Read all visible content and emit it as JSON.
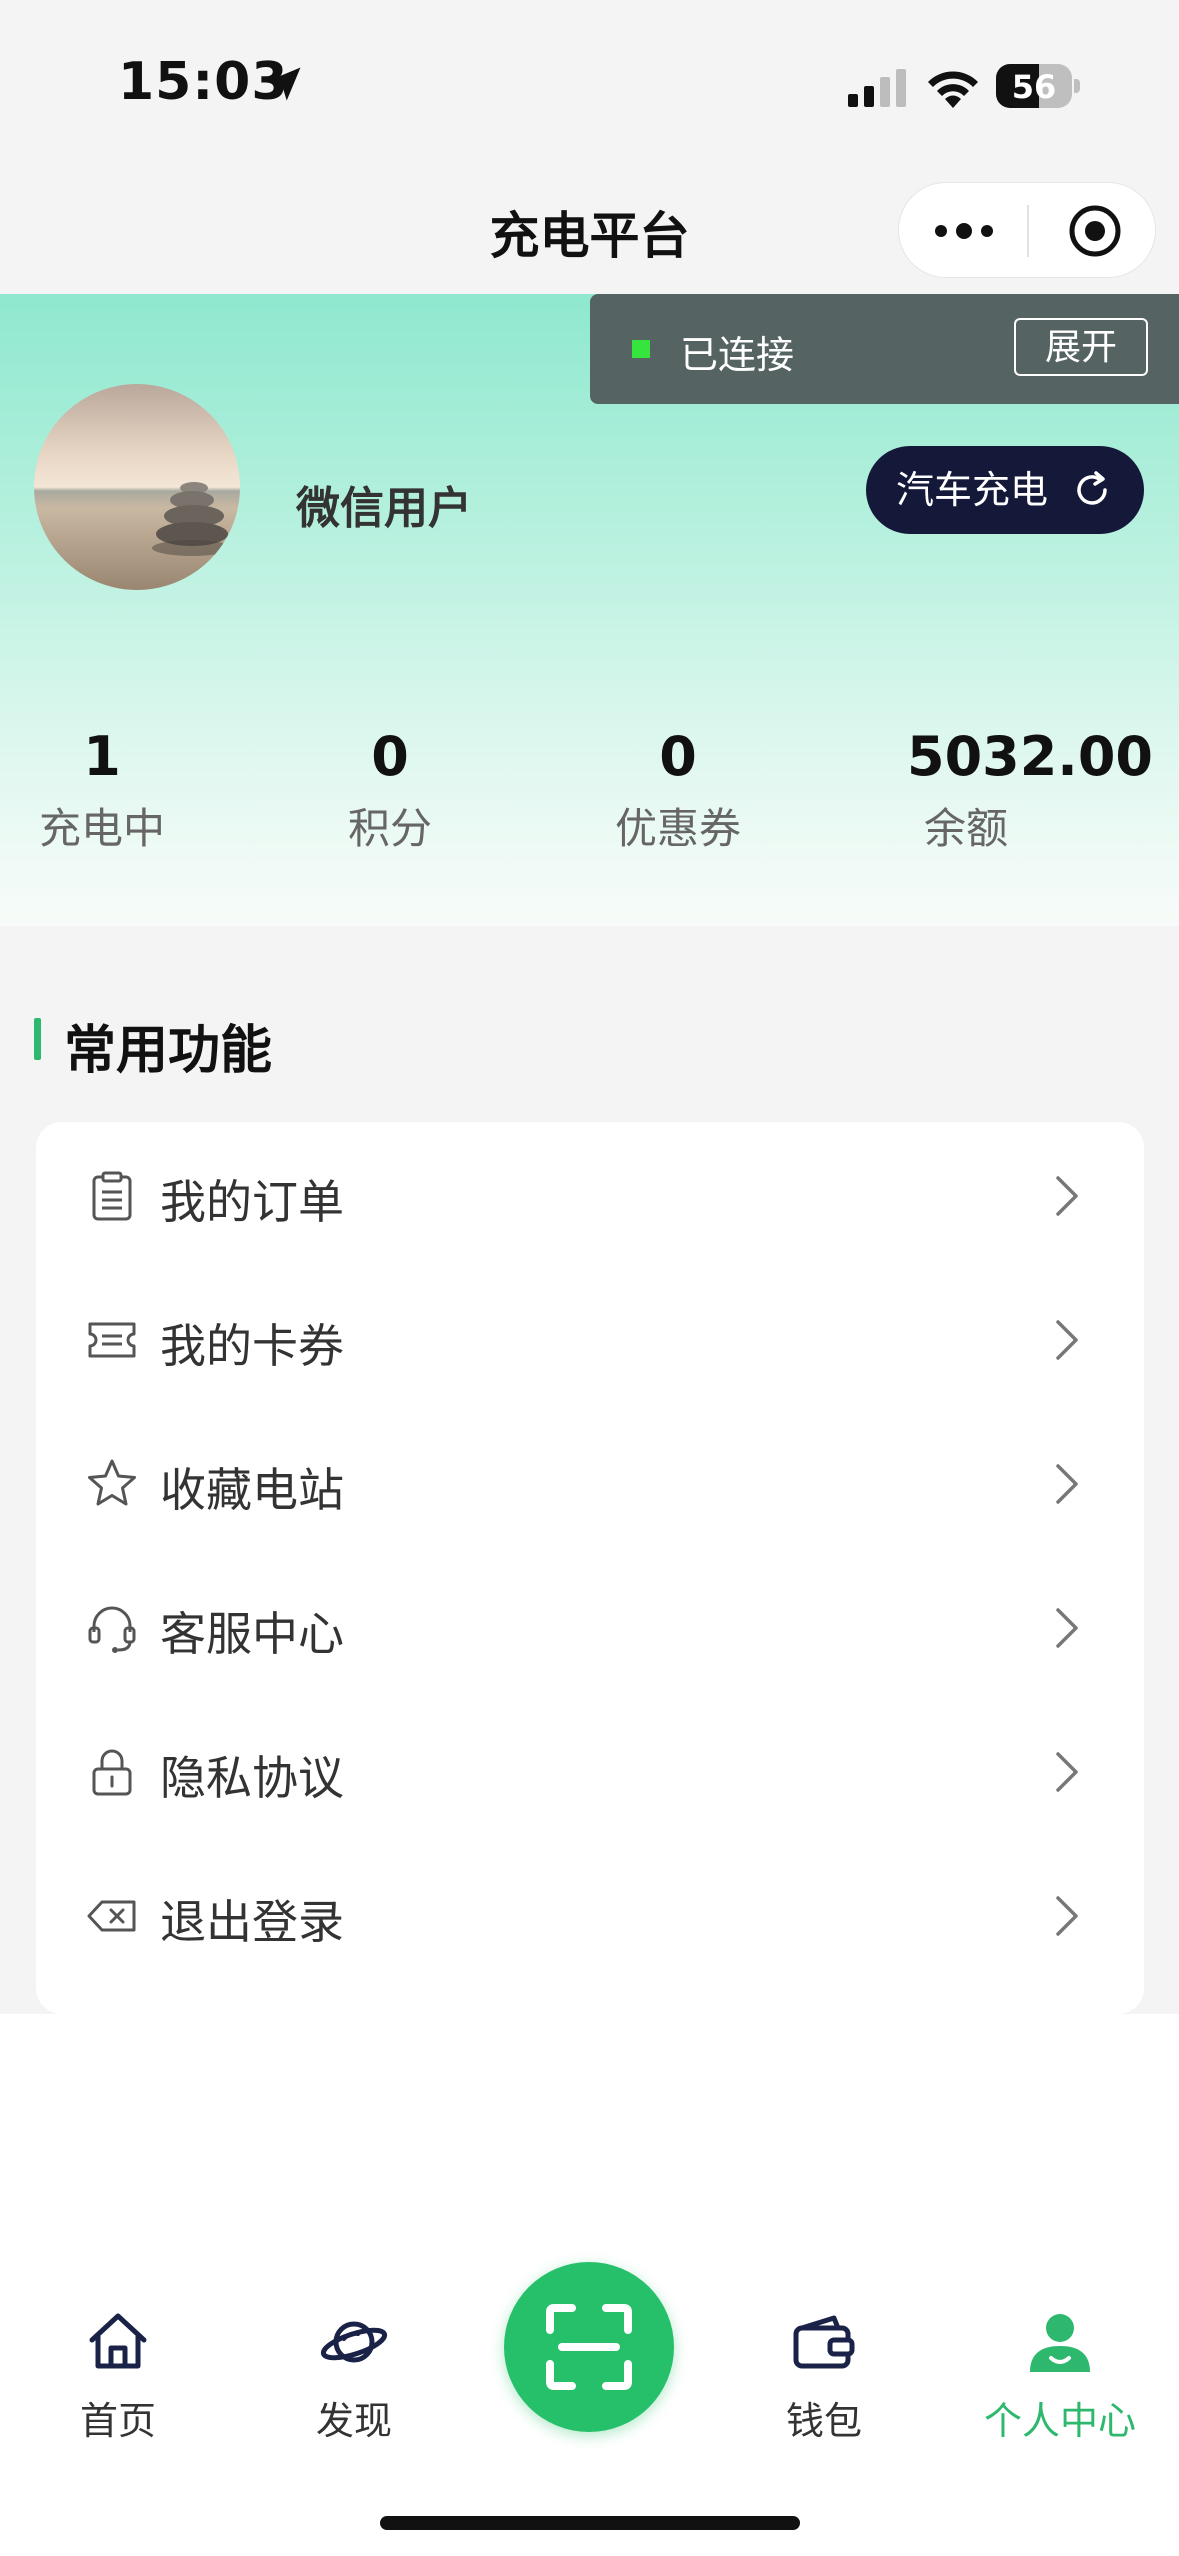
{
  "status_bar": {
    "time": "15:03",
    "battery_level": "56",
    "battery_fraction": 0.56
  },
  "nav": {
    "title": "充电平台"
  },
  "connection": {
    "status_label": "已连接",
    "expand_label": "展开",
    "status_color": "#35e43c"
  },
  "profile": {
    "username": "微信用户",
    "car_charge_label": "汽车充电"
  },
  "stats": [
    {
      "value": "1",
      "label": "充电中"
    },
    {
      "value": "0",
      "label": "积分"
    },
    {
      "value": "0",
      "label": "优惠券"
    },
    {
      "value": "5032.00",
      "label": "余额"
    }
  ],
  "section": {
    "title": "常用功能"
  },
  "menu": [
    {
      "label": "我的订单",
      "icon": "order-list-icon"
    },
    {
      "label": "我的卡券",
      "icon": "ticket-icon"
    },
    {
      "label": "收藏电站",
      "icon": "star-icon"
    },
    {
      "label": "客服中心",
      "icon": "headset-icon"
    },
    {
      "label": "隐私协议",
      "icon": "lock-icon"
    },
    {
      "label": "退出登录",
      "icon": "backspace-icon"
    }
  ],
  "tabbar": {
    "items": [
      {
        "label": "首页",
        "icon": "home-icon"
      },
      {
        "label": "发现",
        "icon": "planet-icon"
      },
      {
        "label": "",
        "icon": "scan-icon"
      },
      {
        "label": "钱包",
        "icon": "wallet-icon"
      },
      {
        "label": "个人中心",
        "icon": "user-icon"
      }
    ],
    "active_index": 4
  },
  "colors": {
    "accent_green": "#2eb86e",
    "scan_button": "#26c06a",
    "car_button_bg": "#14193a",
    "toast_bg": "#556462"
  }
}
